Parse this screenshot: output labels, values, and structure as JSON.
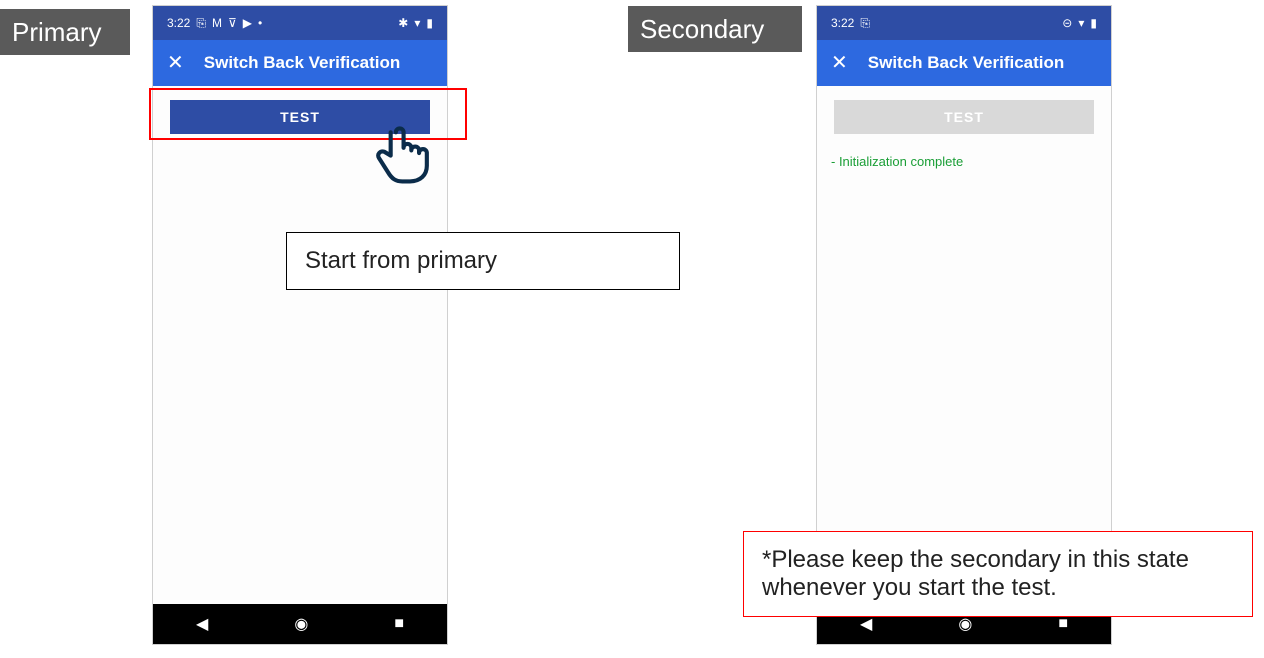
{
  "tags": {
    "primary": "Primary",
    "secondary": "Secondary"
  },
  "statusbar": {
    "time": "3:22",
    "icon_clip": "⎘",
    "icon_gmail": "M",
    "icon_wifi_weak": "⊽",
    "icon_play": "▶",
    "icon_dot": "•",
    "icon_dnd": "⊝",
    "icon_bt": "✱",
    "icon_wifi": "▾",
    "icon_batt": "▮"
  },
  "appbar": {
    "close": "✕",
    "title": "Switch Back Verification"
  },
  "primary": {
    "test_label": "TEST"
  },
  "secondary": {
    "test_label": "TEST",
    "status_msg": "- Initialization complete"
  },
  "nav": {
    "back": "◀",
    "home": "◉",
    "recent": "■"
  },
  "annotations": {
    "start_primary": "Start from primary",
    "keep_secondary": "*Please keep the secondary in this state whenever you start the test."
  }
}
